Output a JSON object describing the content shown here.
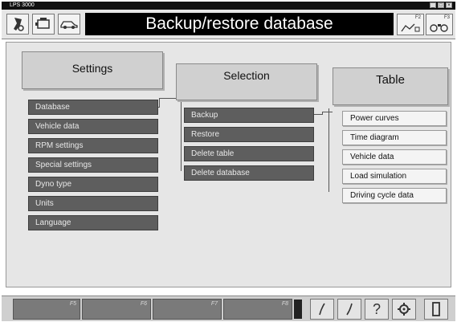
{
  "window": {
    "title": "LPS 3000",
    "controls": [
      "_",
      "□",
      "×"
    ]
  },
  "header": {
    "title": "Backup/restore database",
    "icons": [
      "dyno-icon",
      "engine-icon",
      "car-icon"
    ],
    "f2_label": "F2",
    "f3_label": "F3"
  },
  "columns": {
    "settings": {
      "heading": "Settings",
      "items": [
        "Database",
        "Vehicle data",
        "RPM settings",
        "Special settings",
        "Dyno type",
        "Units",
        "Language"
      ]
    },
    "selection": {
      "heading": "Selection",
      "items": [
        "Backup",
        "Restore",
        "Delete table",
        "Delete database"
      ]
    },
    "table": {
      "heading": "Table",
      "items": [
        "Power curves",
        "Time diagram",
        "Vehicle data",
        "Load simulation",
        "Driving cycle data"
      ]
    }
  },
  "footer": {
    "fkeys": [
      "F5",
      "F6",
      "F7",
      "F8"
    ],
    "buttons": [
      "curve-up-icon",
      "curve-down-icon",
      "help-icon",
      "gear-icon",
      "exit-door-icon"
    ]
  }
}
